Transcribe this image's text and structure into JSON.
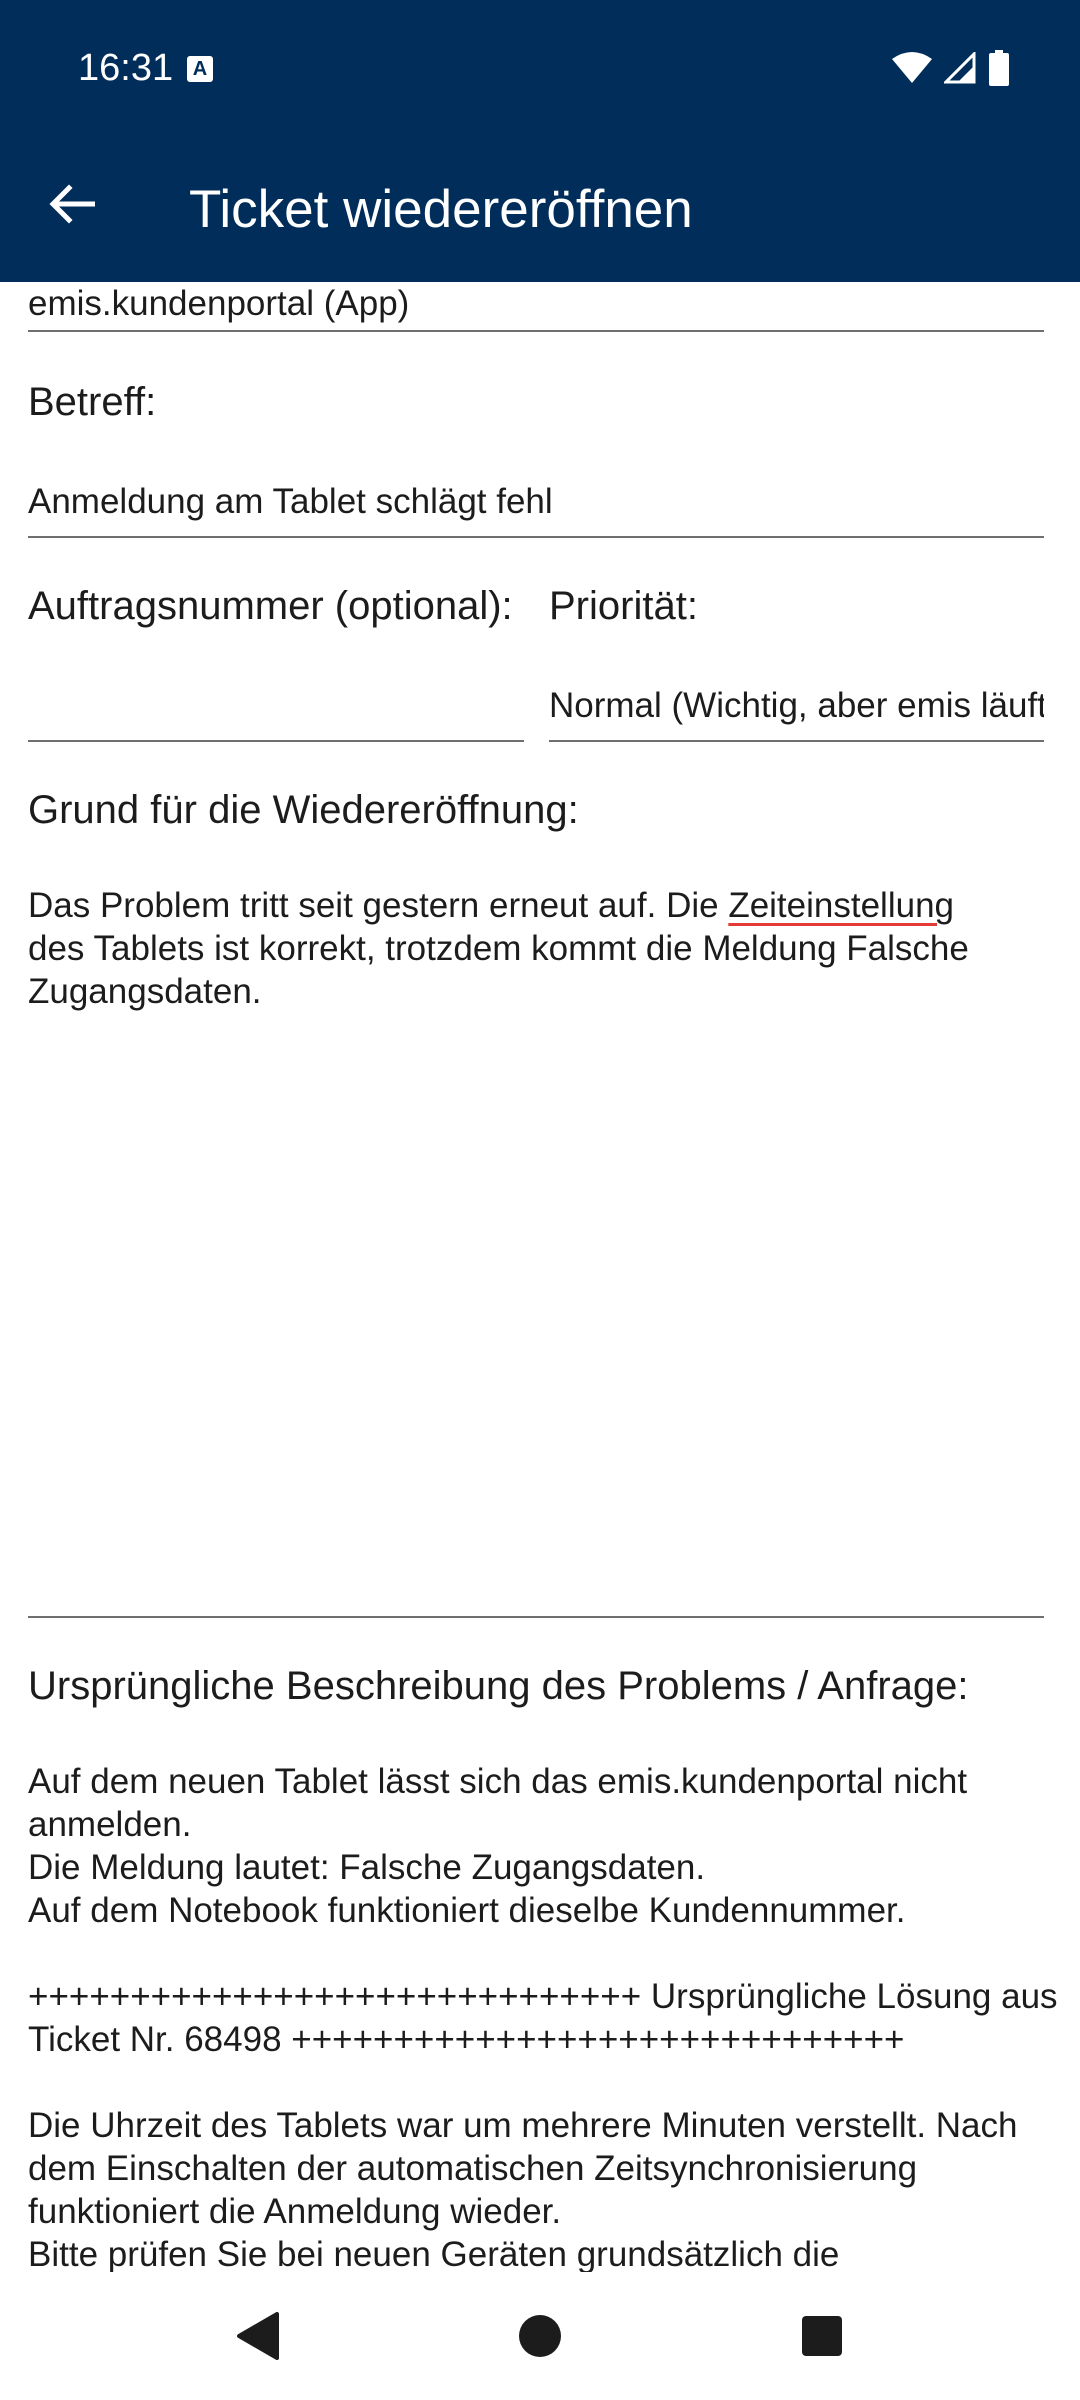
{
  "status_bar": {
    "time": "16:31",
    "notification_icon": "A",
    "icons": [
      "wifi-icon",
      "cellular-signal-icon",
      "battery-icon"
    ]
  },
  "app_bar": {
    "title": "Ticket wiedereröffnen",
    "back_icon": "arrow-back-icon"
  },
  "form": {
    "product_value": "emis.kundenportal (App)",
    "subject_label": "Betreff:",
    "subject_value": "Anmeldung am Tablet schlägt fehl",
    "order_number_label": "Auftragsnummer (optional):",
    "order_number_value": "",
    "priority_label": "Priorität:",
    "priority_value": "Normal (Wichtig, aber emis läuft)",
    "reason_label": "Grund für die Wiedereröffnung:",
    "reason_text_before": "Das Problem tritt seit gestern erneut auf. Die ",
    "reason_text_misspelled": "Zeiteinstellung",
    "reason_text_after": "\ndes Tablets ist korrekt, trotzdem kommt die Meldung Falsche\nZugangsdaten.",
    "original_label": "Ursprüngliche Beschreibung des Problems / Anfrage:",
    "original_text": "Auf dem neuen Tablet lässt sich das emis.kundenportal nicht\nanmelden.\nDie Meldung lautet: Falsche Zugangsdaten.\nAuf dem Notebook funktioniert dieselbe Kundennummer.\n\n++++++++++++++++++++++++++++++ Ursprüngliche Lösung aus\nTicket Nr. 68498 ++++++++++++++++++++++++++++++\n\nDie Uhrzeit des Tablets war um mehrere Minuten verstellt. Nach\ndem Einschalten der automatischen Zeitsynchronisierung\nfunktioniert die Anmeldung wieder.\nBitte prüfen Sie bei neuen Geräten grundsätzlich die"
  },
  "nav_bar": {
    "back": "nav-back-icon",
    "home": "nav-home-icon",
    "recents": "nav-recents-icon"
  },
  "colors": {
    "app_bar": "#002d5a",
    "text": "#1c1c1c",
    "underline": "#6f6f6f",
    "spellcheck": "#e53935",
    "nav_icon": "#1c1c1c"
  }
}
